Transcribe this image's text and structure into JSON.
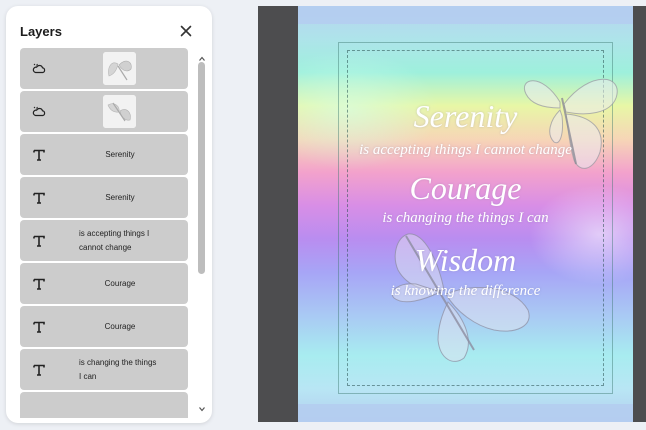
{
  "panel": {
    "title": "Layers",
    "close_icon": "close-icon",
    "layers": [
      {
        "type": "image",
        "icon": "image-cloud-icon",
        "label": ""
      },
      {
        "type": "image",
        "icon": "image-cloud-icon",
        "label": ""
      },
      {
        "type": "text",
        "icon": "text-t-icon",
        "label": "Serenity"
      },
      {
        "type": "text",
        "icon": "text-t-icon",
        "label": "Serenity"
      },
      {
        "type": "text",
        "icon": "text-t-icon",
        "label_line1": "is accepting things I",
        "label_line2": "cannot change"
      },
      {
        "type": "text",
        "icon": "text-t-icon",
        "label": "Courage"
      },
      {
        "type": "text",
        "icon": "text-t-icon",
        "label": "Courage"
      },
      {
        "type": "text",
        "icon": "text-t-icon",
        "label_line1": "is changing the things",
        "label_line2": "I can"
      }
    ]
  },
  "design": {
    "serenity": "Serenity",
    "line1": "is accepting things I cannot change",
    "courage": "Courage",
    "line2": "is changing the things I can",
    "wisdom": "Wisdom",
    "line3": "is knowing the difference"
  },
  "colors": {
    "canvas_background": "#4d4d4f",
    "layer_background": "#cccccc",
    "app_background": "#edf0f5"
  }
}
